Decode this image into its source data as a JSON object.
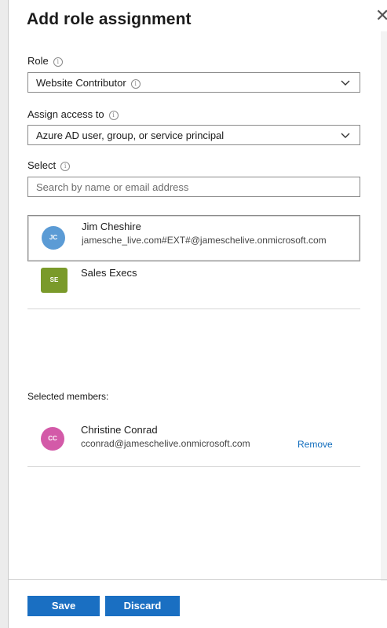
{
  "header": {
    "title": "Add role assignment",
    "close_glyph": "✕"
  },
  "role": {
    "label": "Role",
    "info_glyph": "i",
    "selected": "Website Contributor"
  },
  "assign_access": {
    "label": "Assign access to",
    "selected": "Azure AD user, group, or service principal"
  },
  "select": {
    "label": "Select",
    "placeholder": "Search by name or email address"
  },
  "results": [
    {
      "initials": "JC",
      "name": "Jim Cheshire",
      "detail": "jamesche_live.com#EXT#@jameschelive.onmicrosoft.com",
      "avatar_color": "#5b9bd5",
      "selected": true
    },
    {
      "initials": "SE",
      "name": "Sales Execs",
      "detail": "",
      "avatar_color": "#7a9a2a",
      "selected": false
    }
  ],
  "selected_members": {
    "label": "Selected members:",
    "items": [
      {
        "initials": "CC",
        "name": "Christine Conrad",
        "detail": "cconrad@jameschelive.onmicrosoft.com",
        "avatar_color": "#d35aa8",
        "action": "Remove"
      }
    ]
  },
  "footer": {
    "save_label": "Save",
    "discard_label": "Discard"
  },
  "colors": {
    "accent": "#1a6fc2",
    "link": "#0f6cbd"
  }
}
